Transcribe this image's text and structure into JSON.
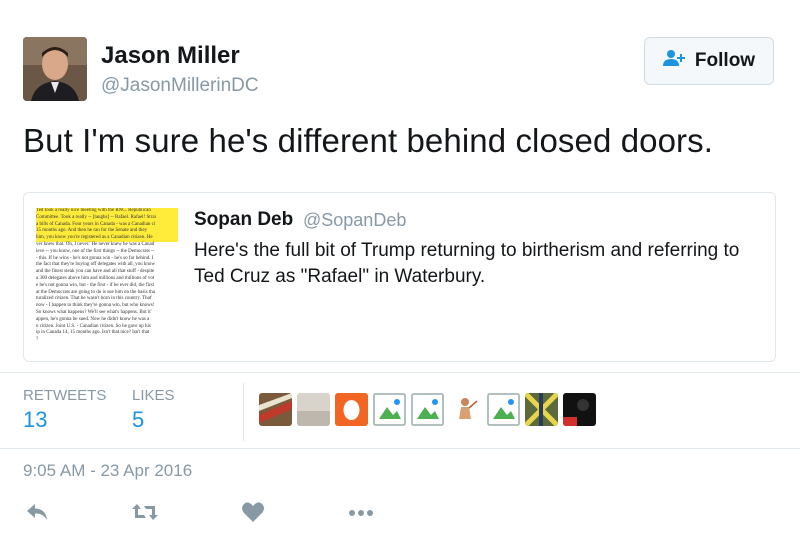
{
  "tweet": {
    "author": {
      "name": "Jason Miller",
      "handle": "@JasonMillerinDC"
    },
    "follow_label": "Follow",
    "text": "But I'm sure he's different behind closed doors.",
    "timestamp": "9:05 AM - 23 Apr 2016"
  },
  "quote": {
    "author": {
      "name": "Sopan Deb",
      "handle": "@SopanDeb"
    },
    "text": "Here's the full bit of Trump returning to birtherism and referring to Ted Cruz as \"Rafael\" in Waterbury.",
    "image_lines": [
      "Ted took a really nice meeting with the RNC. Republican",
      "Committee. Took a really -- [laughs] -- Rafael. Rafael! Strai",
      "a bills of Canada. Four years in Canada - was a Canadian ci",
      "15 months ago. And then he ran for the Senate and they",
      "him, you know you're registered as a Canadian citizen. He",
      "ver knew that. Oh, I never.' He never knew he was a Canad",
      "ieve -- you know, one of the first things -- the Democrats --",
      "- this. If he wins - he's not gonna win - he's so far behind. I",
      "the fact that they're buying off delegates with all, you know",
      "and the finest steak you can have and all that stuff - despite",
      "a 300 delegates above him and millions and millions of vot",
      "e he's not gonna win, but - the first - if he ever did, the first",
      "at the Democrats are going to do is sue him on the basis tha",
      "turalized citizen. That he wasn't born in this country. That'",
      "now - I happen to think they're gonna win, but who knows!",
      "So knows what happens? We'll see what's happens. But it'",
      "appen, he's gonna be sued. Now he didn't know he was a",
      "n citizen. Joint U.S. - Canadian citizen. So he gave up his",
      "ip in Canada 14, 15 months ago. Isn't that nice? Isn't that",
      "?"
    ],
    "highlighted_lines": 5
  },
  "stats": {
    "retweets_label": "RETWEETS",
    "retweets_count": "13",
    "likes_label": "LIKES",
    "likes_count": "5"
  },
  "likers": [
    "liker-avatar-1",
    "liker-avatar-2",
    "liker-avatar-3",
    "liker-avatar-4",
    "liker-avatar-5",
    "liker-avatar-6",
    "liker-avatar-7",
    "liker-avatar-8",
    "liker-avatar-9"
  ],
  "actions": [
    "reply-icon",
    "retweet-icon",
    "like-icon",
    "more-icon"
  ],
  "colors": {
    "link_blue": "#1b95e0",
    "muted": "#8899a6",
    "border": "#e1e8ed",
    "highlight": "#ffec3a"
  }
}
